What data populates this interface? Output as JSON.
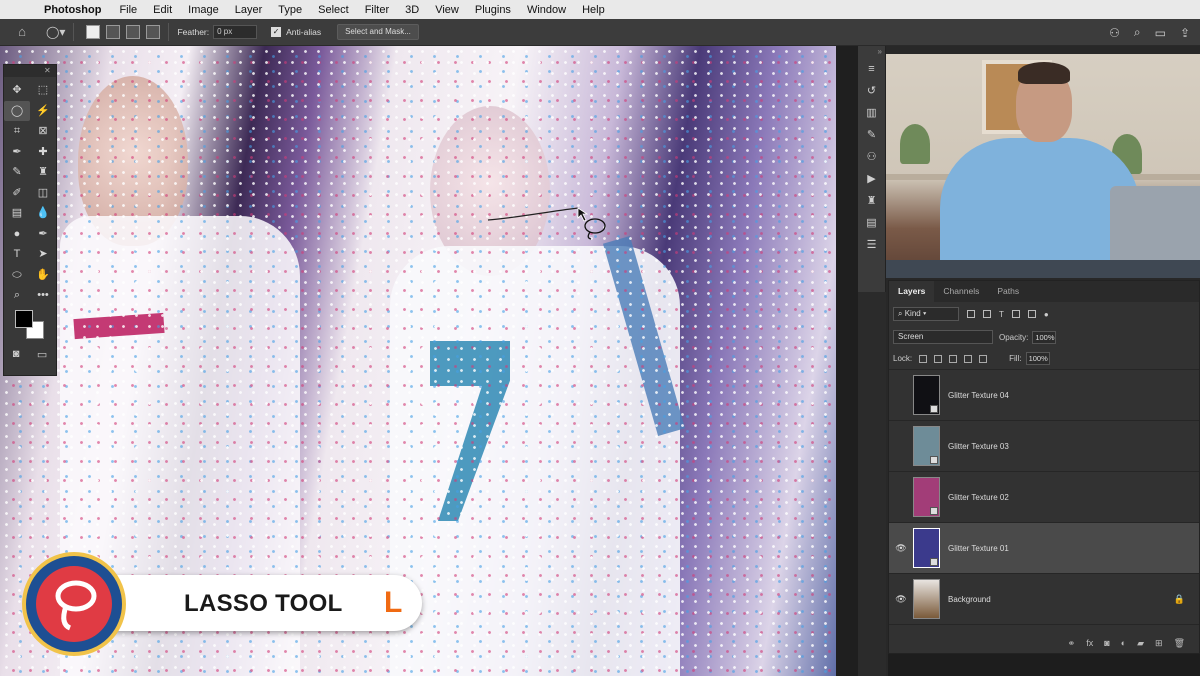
{
  "menubar": {
    "app_name": "Photoshop",
    "items": [
      "File",
      "Edit",
      "Image",
      "Layer",
      "Type",
      "Select",
      "Filter",
      "3D",
      "View",
      "Plugins",
      "Window",
      "Help"
    ]
  },
  "options": {
    "feather_label": "Feather:",
    "feather_value": "0 px",
    "antialias_label": "Anti-alias",
    "select_mask_label": "Select and Mask..."
  },
  "overlay": {
    "tool_name": "LASSO TOOL",
    "shortcut": "L"
  },
  "layers_panel": {
    "tabs": [
      "Layers",
      "Channels",
      "Paths"
    ],
    "kind_label": "Kind",
    "blend_mode": "Screen",
    "opacity_label": "Opacity:",
    "opacity_value": "100%",
    "lock_label": "Lock:",
    "fill_label": "Fill:",
    "fill_value": "100%",
    "layers": [
      {
        "name": "Glitter Texture 04"
      },
      {
        "name": "Glitter Texture 03"
      },
      {
        "name": "Glitter Texture 02"
      },
      {
        "name": "Glitter Texture 01"
      },
      {
        "name": "Background"
      }
    ]
  },
  "colors": {
    "accent_orange": "#f06a12",
    "selected_layer_bg": "#4a4a4a",
    "panel_bg": "#323232"
  }
}
